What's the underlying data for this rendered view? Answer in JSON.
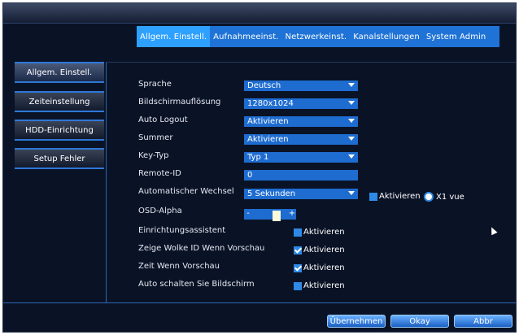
{
  "tabs": [
    {
      "label": "Allgem. Einstell.",
      "active": true
    },
    {
      "label": "Aufnahmeeinst."
    },
    {
      "label": "Netzwerkeinst."
    },
    {
      "label": "Kanalstellungen"
    },
    {
      "label": "System Admin"
    }
  ],
  "sidebar": {
    "items": [
      {
        "label": "Allgem. Einstell.",
        "active": true
      },
      {
        "label": "Zeiteinstellung"
      },
      {
        "label": "HDD-Einrichtung"
      },
      {
        "label": "Setup Fehler"
      }
    ]
  },
  "form": {
    "sprache": {
      "label": "Sprache",
      "value": "Deutsch"
    },
    "aufloesung": {
      "label": "Bildschirmauflösung",
      "value": "1280x1024"
    },
    "logout": {
      "label": "Auto Logout",
      "value": "Aktivieren"
    },
    "summer": {
      "label": "Summer",
      "value": "Aktivieren"
    },
    "keytyp": {
      "label": "Key-Typ",
      "value": "Typ 1"
    },
    "remote": {
      "label": "Remote-ID",
      "value": "0"
    },
    "wechsel": {
      "label": "Automatischer Wechsel",
      "value": "5 Sekunden",
      "check_label": "Aktivieren",
      "radio_label": "X1 vue"
    },
    "osd": {
      "label": "OSD-Alpha",
      "minus": "-",
      "plus": "+",
      "level": 0.75
    },
    "assistent": {
      "label": "Einrichtungsassistent",
      "check_label": "Aktivieren",
      "checked": false
    },
    "wolke": {
      "label": "Zeige Wolke ID Wenn Vorschau",
      "check_label": "Aktivieren",
      "checked": true
    },
    "zeit": {
      "label": "Zeit Wenn Vorschau",
      "check_label": "Aktivieren",
      "checked": true
    },
    "auto_screen": {
      "label": "Auto schalten Sie Bildschirm",
      "check_label": "Aktivieren",
      "checked": false
    }
  },
  "buttons": {
    "apply": "Übernehmen",
    "ok": "Okay",
    "cancel": "Abbr"
  },
  "colors": {
    "accent": "#1e6cd0",
    "tab_active": "#2ea0ff",
    "background": "#0a1326"
  }
}
